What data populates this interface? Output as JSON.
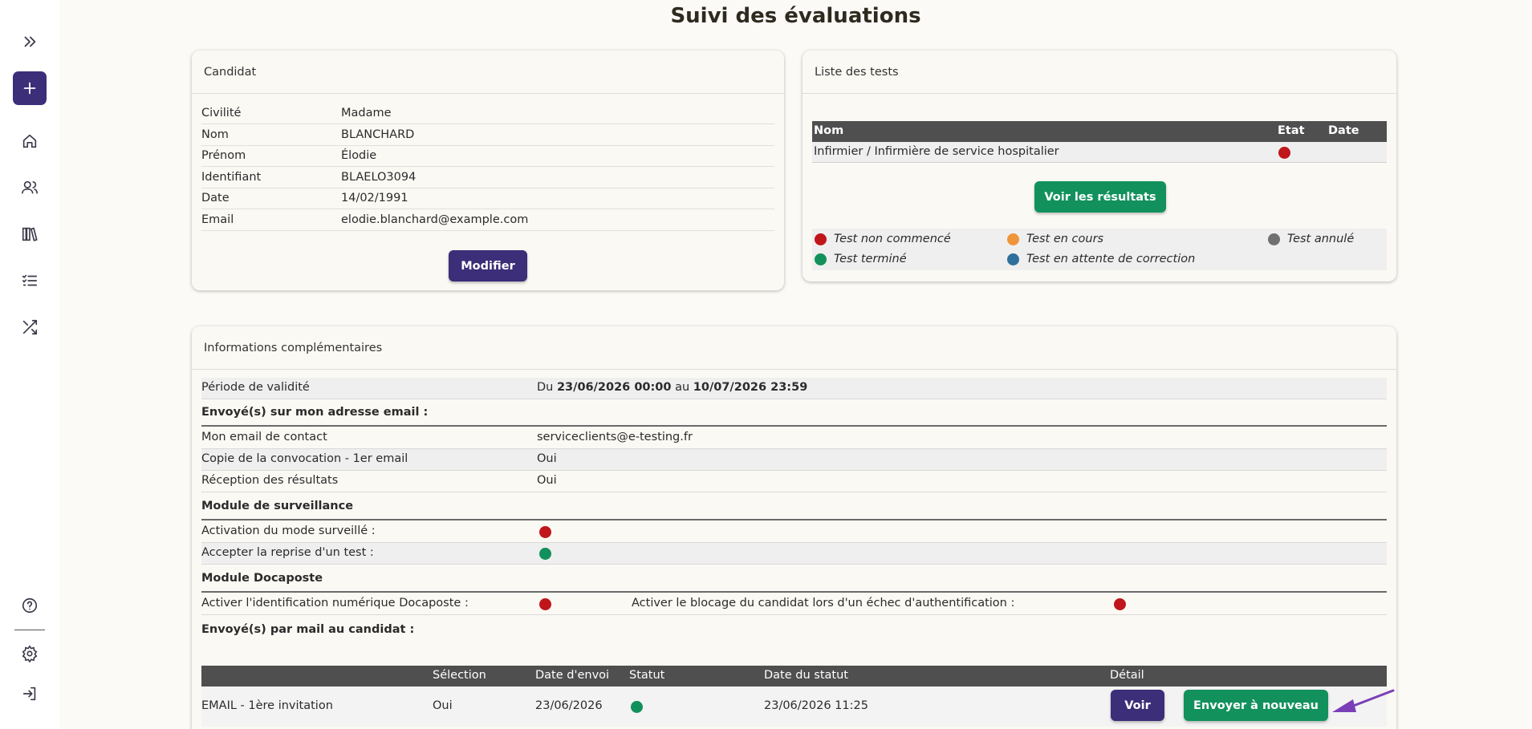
{
  "page": {
    "title": "Suivi des évaluations"
  },
  "sidebar": {
    "items": [
      {
        "name": "expand-icon"
      },
      {
        "name": "plus-icon"
      },
      {
        "name": "home-icon"
      },
      {
        "name": "users-icon"
      },
      {
        "name": "library-icon"
      },
      {
        "name": "checklist-icon"
      },
      {
        "name": "shuffle-icon"
      },
      {
        "name": "help-icon"
      },
      {
        "name": "settings-icon"
      },
      {
        "name": "logout-icon"
      }
    ]
  },
  "candidate": {
    "header": "Candidat",
    "fields": [
      {
        "label": "Civilité",
        "value": "Madame"
      },
      {
        "label": "Nom",
        "value": "BLANCHARD"
      },
      {
        "label": "Prénom",
        "value": "Élodie"
      },
      {
        "label": "Identifiant",
        "value": "BLAELO3094"
      },
      {
        "label": "Date",
        "value": "14/02/1991"
      },
      {
        "label": "Email",
        "value": "elodie.blanchard@example.com"
      }
    ],
    "edit_button": "Modifier"
  },
  "tests": {
    "header": "Liste des tests",
    "columns": {
      "name": "Nom",
      "state": "Etat",
      "date": "Date"
    },
    "rows": [
      {
        "name": "Infirmier / Infirmière de service hospitalier",
        "state_color": "#c0161b",
        "date": ""
      }
    ],
    "results_button": "Voir les résultats",
    "legend": [
      {
        "label": "Test non commencé",
        "color": "#c0161b"
      },
      {
        "label": "Test en cours",
        "color": "#f0943a"
      },
      {
        "label": "Test annulé",
        "color": "#707070"
      },
      {
        "label": "Test terminé",
        "color": "#12915d"
      },
      {
        "label": "Test en attente de correction",
        "color": "#2f6f9c"
      }
    ]
  },
  "info": {
    "header": "Informations complémentaires",
    "validity": {
      "label": "Période de validité",
      "prefix": "Du",
      "start": "23/06/2026 00:00",
      "middle": "au",
      "end": "10/07/2026 23:59"
    },
    "email_section": {
      "title": "Envoyé(s) sur mon adresse email :",
      "rows": [
        {
          "label": "Mon email de contact",
          "value": "serviceclients@e-testing.fr"
        },
        {
          "label": "Copie de la convocation - 1er email",
          "value": "Oui"
        },
        {
          "label": "Réception des résultats",
          "value": "Oui"
        }
      ]
    },
    "surveillance_section": {
      "title": "Module de surveillance",
      "rows": [
        {
          "label": "Activation du mode surveillé :",
          "color": "#c0161b"
        },
        {
          "label": "Accepter la reprise d'un test :",
          "color": "#12915d"
        }
      ]
    },
    "docaposte_section": {
      "title": "Module Docaposte",
      "label1": "Activer l'identification numérique Docaposte :",
      "color1": "#c0161b",
      "label2": "Activer le blocage du candidat lors d'un échec d'authentification :",
      "color2": "#c0161b"
    },
    "mail_section": {
      "title": "Envoyé(s) par mail au candidat :",
      "columns": {
        "type": "",
        "selection": "Sélection",
        "sent": "Date d'envoi",
        "status": "Statut",
        "status_date": "Date du statut",
        "detail": "Détail"
      },
      "rows": [
        {
          "type": "EMAIL - 1ère invitation",
          "selection": "Oui",
          "sent": "23/06/2026",
          "status_color": "#12915d",
          "status_date": "23/06/2026 11:25",
          "view_button": "Voir",
          "resend_button": "Envoyer à nouveau"
        }
      ]
    }
  },
  "colors": {
    "primary": "#3c2e78",
    "success": "#12915d",
    "danger": "#c0161b",
    "annotation": "#7a3fb8"
  }
}
